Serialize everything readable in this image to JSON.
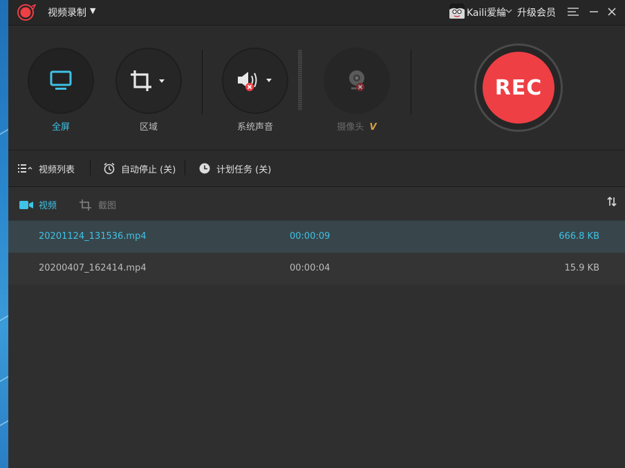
{
  "titlebar": {
    "app_title": "视频录制",
    "username": "Kaili爱綸",
    "upgrade_label": "升级会员"
  },
  "modes": [
    {
      "label": "全屏",
      "icon": "monitor-icon",
      "state": "active"
    },
    {
      "label": "区域",
      "icon": "crop-icon",
      "state": "normal"
    },
    {
      "label": "系统声音",
      "icon": "speaker-muted-icon",
      "state": "normal"
    },
    {
      "label": "摄像头",
      "icon": "webcam-icon",
      "state": "disabled",
      "badge": "V"
    }
  ],
  "rec_button": {
    "label": "REC",
    "color": "#ee3f45"
  },
  "subbar": {
    "video_list": "视频列表",
    "auto_stop": "自动停止 (关)",
    "schedule": "计划任务 (关)"
  },
  "tabs": [
    {
      "label": "视频",
      "icon": "video-camera-icon",
      "active": true
    },
    {
      "label": "截图",
      "icon": "crop-icon",
      "active": false
    }
  ],
  "files": [
    {
      "name": "20201124_131536.mp4",
      "duration": "00:00:09",
      "size": "666.8 KB",
      "selected": true
    },
    {
      "name": "20200407_162414.mp4",
      "duration": "00:00:04",
      "size": "15.9 KB",
      "selected": false
    }
  ],
  "colors": {
    "accent": "#3fc2e6",
    "rec": "#ee3f45",
    "background": "#2f2f2f"
  }
}
